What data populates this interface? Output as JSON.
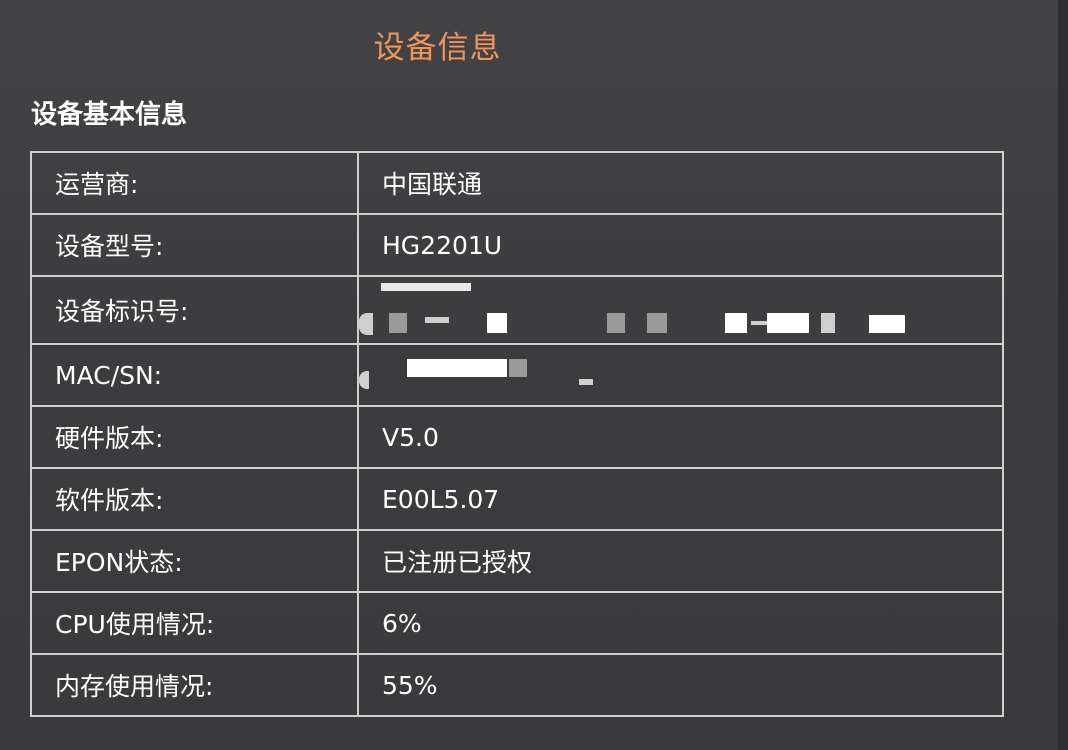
{
  "page_title": "设备信息",
  "section_title": "设备基本信息",
  "rows": [
    {
      "label": "运营商:",
      "value": "中国联通"
    },
    {
      "label": "设备型号:",
      "value": "HG2201U"
    },
    {
      "label": "设备标识号:",
      "value": ""
    },
    {
      "label": "MAC/SN:",
      "value": ""
    },
    {
      "label": "硬件版本:",
      "value": "V5.0"
    },
    {
      "label": "软件版本:",
      "value": "E00L5.07"
    },
    {
      "label": "EPON状态:",
      "value": "已注册已授权"
    },
    {
      "label": "CPU使用情况:",
      "value": "6%"
    },
    {
      "label": "内存使用情况:",
      "value": "55%"
    }
  ],
  "colors": {
    "title": "#f0955a",
    "background": "#3d3d3f",
    "border": "#cfcfcf",
    "text": "#ffffff"
  }
}
